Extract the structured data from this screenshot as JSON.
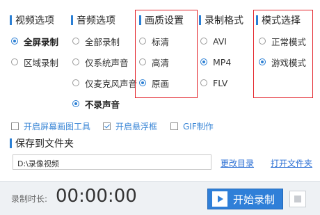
{
  "sections": {
    "video": {
      "title": "视频选项",
      "options": [
        {
          "label": "全屏录制",
          "selected": true
        },
        {
          "label": "区域录制",
          "selected": false
        }
      ]
    },
    "audio": {
      "title": "音频选项",
      "options": [
        {
          "label": "全部录制",
          "selected": false
        },
        {
          "label": "仅系统声音",
          "selected": false
        },
        {
          "label": "仅麦克风声音",
          "selected": false
        },
        {
          "label": "不录声音",
          "selected": true
        }
      ]
    },
    "quality": {
      "title": "画质设置",
      "options": [
        {
          "label": "标清",
          "selected": false
        },
        {
          "label": "高清",
          "selected": false
        },
        {
          "label": "原画",
          "selected": true
        }
      ]
    },
    "format": {
      "title": "录制格式",
      "options": [
        {
          "label": "AVI",
          "selected": false
        },
        {
          "label": "MP4",
          "selected": true
        },
        {
          "label": "FLV",
          "selected": false
        }
      ]
    },
    "mode": {
      "title": "模式选择",
      "options": [
        {
          "label": "正常模式",
          "selected": false
        },
        {
          "label": "游戏模式",
          "selected": true
        }
      ]
    }
  },
  "checkboxes": [
    {
      "label": "开启屏幕画图工具",
      "checked": false
    },
    {
      "label": "开启悬浮框",
      "checked": true
    },
    {
      "label": "GIF制作",
      "checked": false
    }
  ],
  "save": {
    "title": "保存到文件夹",
    "path": "D:\\录像视频",
    "change_dir": "更改目录",
    "open_folder": "打开文件夹"
  },
  "footer": {
    "duration_label": "录制时长:",
    "duration": "00:00:00",
    "start_label": "开始录制"
  },
  "colors": {
    "accent": "#2b7fd4",
    "highlight_box": "#e3242b"
  }
}
